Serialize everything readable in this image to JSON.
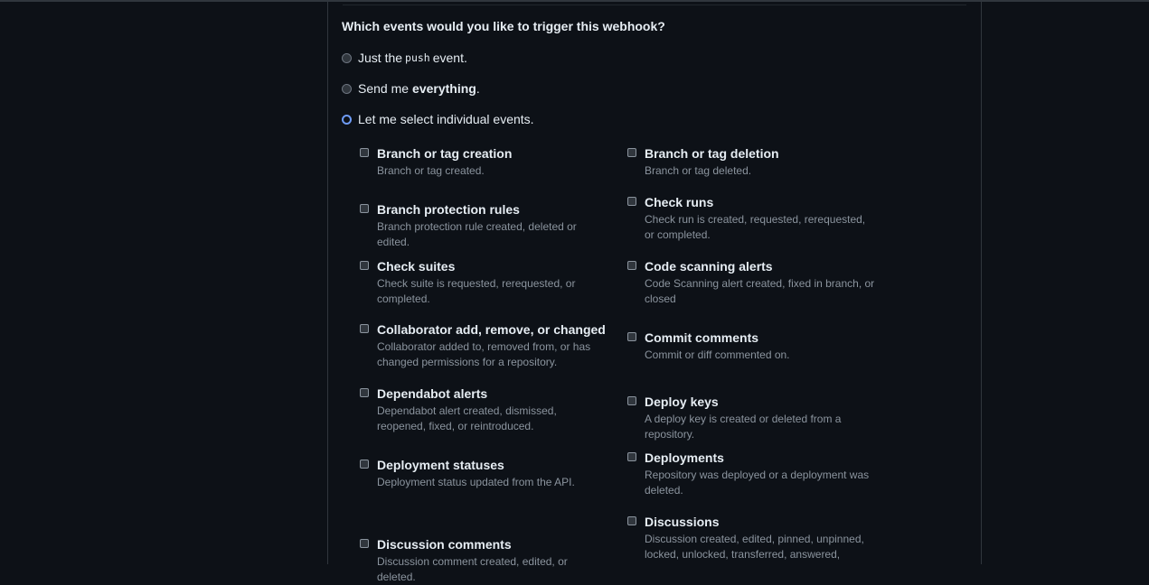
{
  "question": "Which events would you like to trigger this webhook?",
  "radios": {
    "push": {
      "before": "Just the",
      "code": "push",
      "after": "event."
    },
    "everything": {
      "before": "Send me",
      "bold": "everything",
      "after": "."
    },
    "individual": {
      "label": "Let me select individual events."
    }
  },
  "left_events": [
    {
      "title": "Branch or tag creation",
      "desc": "Branch or tag created."
    },
    {
      "title": "Branch protection rules",
      "desc": "Branch protection rule created, deleted or edited."
    },
    {
      "title": "Check suites",
      "desc": "Check suite is requested, rerequested, or completed."
    },
    {
      "title": "Collaborator add, remove, or changed",
      "desc": "Collaborator added to, removed from, or has changed permissions for a repository."
    },
    {
      "title": "Dependabot alerts",
      "desc": "Dependabot alert created, dismissed, reopened, fixed, or reintroduced."
    },
    {
      "title": "Deployment statuses",
      "desc": "Deployment status updated from the API."
    },
    {
      "title": "Discussion comments",
      "desc": "Discussion comment created, edited, or deleted."
    }
  ],
  "right_events": [
    {
      "title": "Branch or tag deletion",
      "desc": "Branch or tag deleted."
    },
    {
      "title": "Check runs",
      "desc": "Check run is created, requested, rerequested, or completed."
    },
    {
      "title": "Code scanning alerts",
      "desc": "Code Scanning alert created, fixed in branch, or closed"
    },
    {
      "title": "Commit comments",
      "desc": "Commit or diff commented on."
    },
    {
      "title": "Deploy keys",
      "desc": "A deploy key is created or deleted from a repository."
    },
    {
      "title": "Deployments",
      "desc": "Repository was deployed or a deployment was deleted."
    },
    {
      "title": "Discussions",
      "desc": "Discussion created, edited, pinned, unpinned, locked, unlocked, transferred, answered,"
    }
  ]
}
